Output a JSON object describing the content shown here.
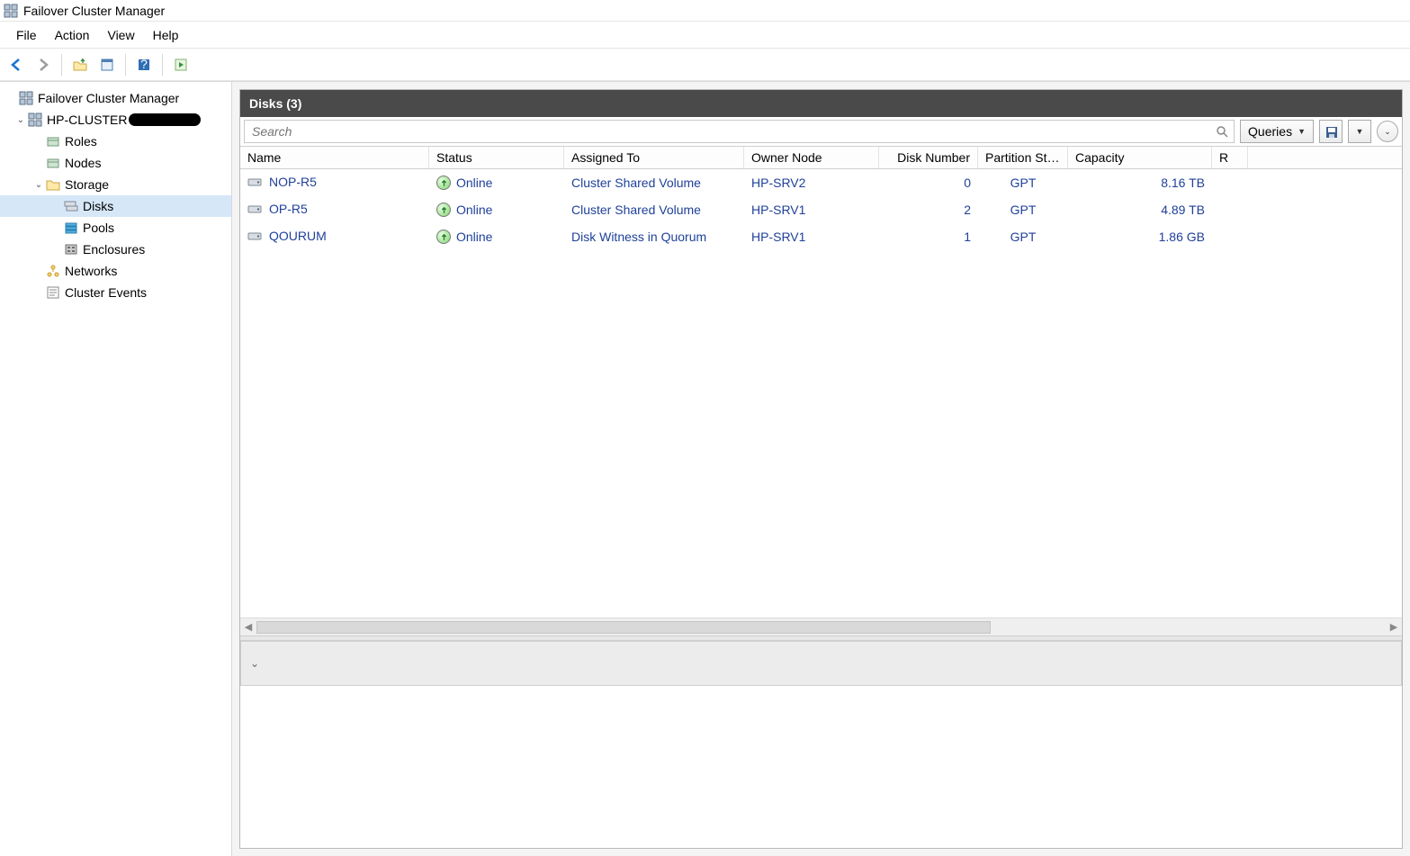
{
  "app_title": "Failover Cluster Manager",
  "menu": {
    "file": "File",
    "action": "Action",
    "view": "View",
    "help": "Help"
  },
  "search": {
    "placeholder": "Search",
    "queries_label": "Queries"
  },
  "tree": {
    "root": "Failover Cluster Manager",
    "cluster": "HP-CLUSTER",
    "roles": "Roles",
    "nodes": "Nodes",
    "storage": "Storage",
    "disks": "Disks",
    "pools": "Pools",
    "enclosures": "Enclosures",
    "networks": "Networks",
    "events": "Cluster Events"
  },
  "panel": {
    "title": "Disks (3)"
  },
  "columns": {
    "name": "Name",
    "status": "Status",
    "assigned": "Assigned To",
    "owner": "Owner Node",
    "dnum": "Disk Number",
    "pstyle": "Partition Style",
    "capacity": "Capacity",
    "extra": "R"
  },
  "status_online": "Online",
  "rows": [
    {
      "name": "NOP-R5",
      "status": "Online",
      "assigned": "Cluster Shared Volume",
      "owner": "HP-SRV2",
      "dnum": "0",
      "pstyle": "GPT",
      "capacity": "8.16 TB"
    },
    {
      "name": "OP-R5",
      "status": "Online",
      "assigned": "Cluster Shared Volume",
      "owner": "HP-SRV1",
      "dnum": "2",
      "pstyle": "GPT",
      "capacity": "4.89 TB"
    },
    {
      "name": "QOURUM",
      "status": "Online",
      "assigned": "Disk Witness in Quorum",
      "owner": "HP-SRV1",
      "dnum": "1",
      "pstyle": "GPT",
      "capacity": "1.86 GB"
    }
  ]
}
